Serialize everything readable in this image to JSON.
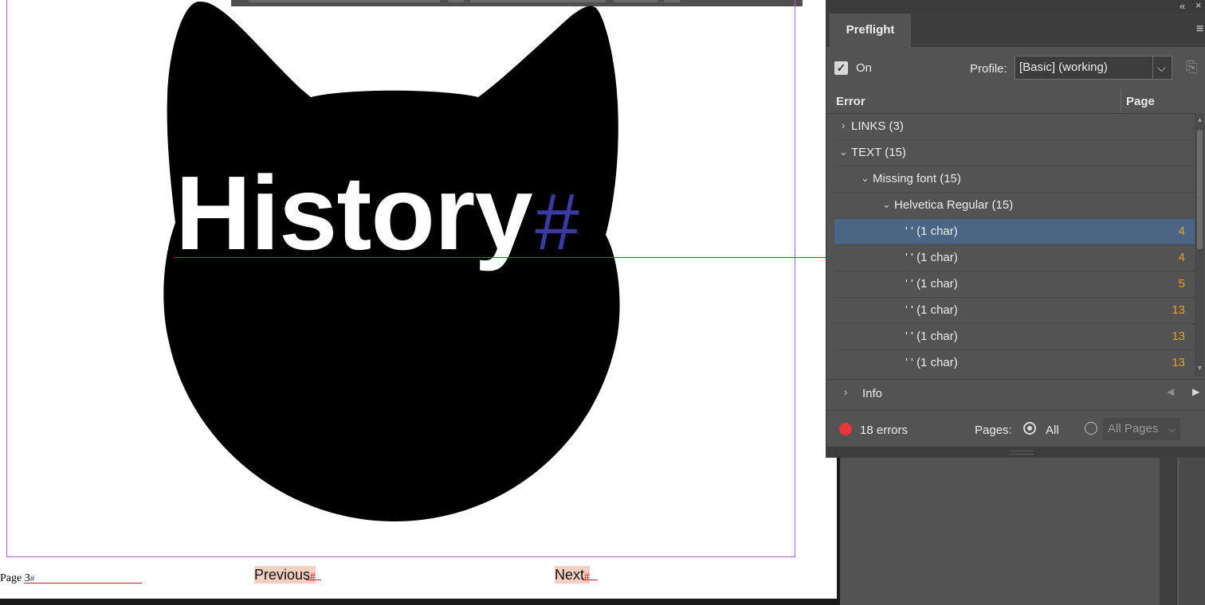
{
  "document": {
    "headline": "History",
    "headline_marker": "#",
    "page_label": "Page 3",
    "page_marker": "#",
    "nav": {
      "previous_label": "Previous",
      "next_label": "Next",
      "marker": "#"
    },
    "colors": {
      "guide_magenta": "#b45ccf",
      "baseline_red": "#c8242c",
      "button_fill": "#f5cfc0",
      "hash_blue": "#3a3aa0"
    }
  },
  "panel": {
    "tab_label": "Preflight",
    "on_label": "On",
    "on_checked": true,
    "profile_label": "Profile:",
    "profile_value": "[Basic] (working)",
    "columns": {
      "error": "Error",
      "page": "Page"
    },
    "rows": [
      {
        "label": "LINKS (3)",
        "expanded": false,
        "page": ""
      },
      {
        "label": "TEXT (15)",
        "expanded": true,
        "page": ""
      },
      {
        "label": "Missing font (15)",
        "expanded": true,
        "page": ""
      },
      {
        "label": "Helvetica Regular (15)",
        "expanded": true,
        "page": ""
      },
      {
        "label": "' ' (1 char)",
        "page": "4",
        "selected": true
      },
      {
        "label": "' ' (1 char)",
        "page": "4"
      },
      {
        "label": "' ' (1 char)",
        "page": "5"
      },
      {
        "label": "' ' (1 char)",
        "page": "13"
      },
      {
        "label": "' ' (1 char)",
        "page": "13"
      },
      {
        "label": "' ' (1 char)",
        "page": "13"
      }
    ],
    "info_label": "Info",
    "error_count": "18 errors",
    "pages_label": "Pages:",
    "pages_all_label": "All",
    "pages_range_value": "All Pages",
    "colors": {
      "error_dot": "#e63838",
      "page_number": "#f0a020",
      "selection": "#4b6585"
    }
  }
}
